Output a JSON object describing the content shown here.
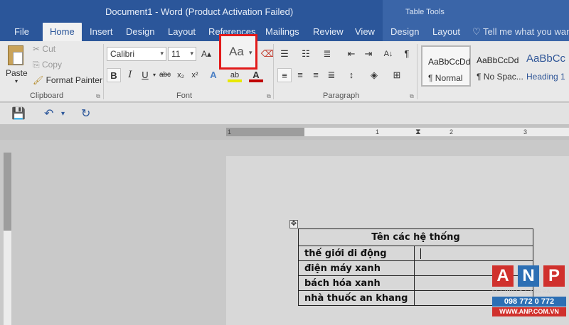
{
  "window": {
    "title": "Document1 - Word (Product Activation Failed)",
    "context_tab_group": "Table Tools"
  },
  "tabs": [
    {
      "label": "File"
    },
    {
      "label": "Home"
    },
    {
      "label": "Insert"
    },
    {
      "label": "Design"
    },
    {
      "label": "Layout"
    },
    {
      "label": "References"
    },
    {
      "label": "Mailings"
    },
    {
      "label": "Review"
    },
    {
      "label": "View"
    },
    {
      "label": "Design"
    },
    {
      "label": "Layout"
    }
  ],
  "tell_me": "Tell me what you want",
  "clipboard": {
    "paste": "Paste",
    "cut": "Cut",
    "copy": "Copy",
    "format_painter": "Format Painter",
    "group_label": "Clipboard"
  },
  "font": {
    "family": "Calibri",
    "size": "11",
    "change_case": "Aa",
    "group_label": "Font",
    "bold": "B",
    "italic": "I",
    "underline": "U",
    "strike": "abc",
    "subscript": "x₂",
    "superscript": "x²",
    "text_effects": "A",
    "highlight": "ab",
    "font_color": "A"
  },
  "paragraph": {
    "group_label": "Paragraph"
  },
  "styles": [
    {
      "sample": "AaBbCcDd",
      "name": "¶ Normal"
    },
    {
      "sample": "AaBbCcDd",
      "name": "¶ No Spac..."
    },
    {
      "sample": "AaBbCc",
      "name": "Heading 1"
    }
  ],
  "ruler_ticks": [
    "1",
    "1",
    "2",
    "3"
  ],
  "table": {
    "header": "Tên các hệ thống",
    "rows": [
      "thế giới di động",
      "điện máy xanh",
      "bách hóa xanh",
      "nhà thuốc an khang"
    ]
  },
  "watermark": {
    "letters": [
      "A",
      "N",
      "P"
    ],
    "tagline": "SECURITY CAMERA",
    "phone": "098 772 0 772",
    "website": "WWW.ANP.COM.VN"
  },
  "colors": {
    "word_blue": "#2b569a",
    "highlight_red": "#e21b1b",
    "anp_blue": "#2c6fb4",
    "anp_red": "#d0312d"
  }
}
